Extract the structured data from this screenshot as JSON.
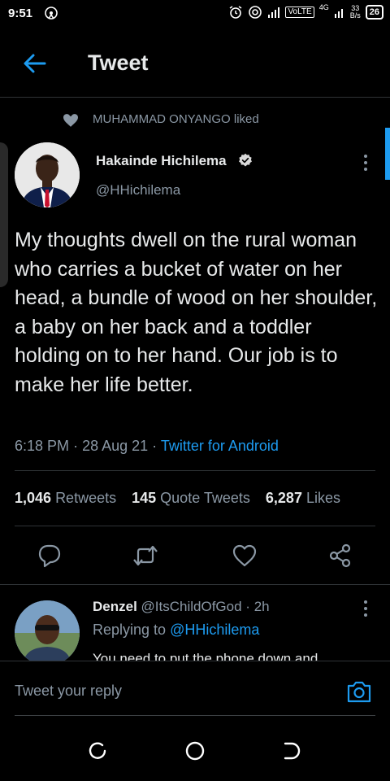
{
  "status_bar": {
    "time": "9:51",
    "network_label": "VoLTE",
    "net_type": "4G",
    "speed_value": "33",
    "speed_unit": "B/s",
    "battery": "26"
  },
  "header": {
    "title": "Tweet"
  },
  "social_context": {
    "text": "MUHAMMAD ONYANGO liked"
  },
  "tweet": {
    "author_name": "Hakainde Hichilema",
    "author_handle": "@HHichilema",
    "text": "My thoughts dwell on the rural woman who carries a bucket of water on her head, a bundle of wood on her shoulder, a baby on her back and a toddler holding on to her hand. Our job is to make her life better.",
    "time": "6:18 PM",
    "date": "28 Aug 21",
    "source": "Twitter for Android",
    "retweets_count": "1,046",
    "retweets_label": "Retweets",
    "quotes_count": "145",
    "quotes_label": "Quote Tweets",
    "likes_count": "6,287",
    "likes_label": "Likes"
  },
  "reply": {
    "name": "Denzel",
    "handle": "@ItsChildOfGod",
    "age": "2h",
    "replying_label": "Replying to",
    "replying_to": "@HHichilema",
    "text": "You need to put the phone down and"
  },
  "compose": {
    "placeholder": "Tweet your reply"
  },
  "colors": {
    "accent": "#1d9bf0",
    "background": "#000000",
    "secondary_text": "#8b98a5"
  },
  "icons": {
    "back": "arrow-left-icon",
    "verified": "verified-badge-icon",
    "more": "more-vertical-icon",
    "reply": "comment-icon",
    "retweet": "retweet-icon",
    "like": "heart-icon",
    "share": "share-icon",
    "camera": "camera-icon"
  }
}
